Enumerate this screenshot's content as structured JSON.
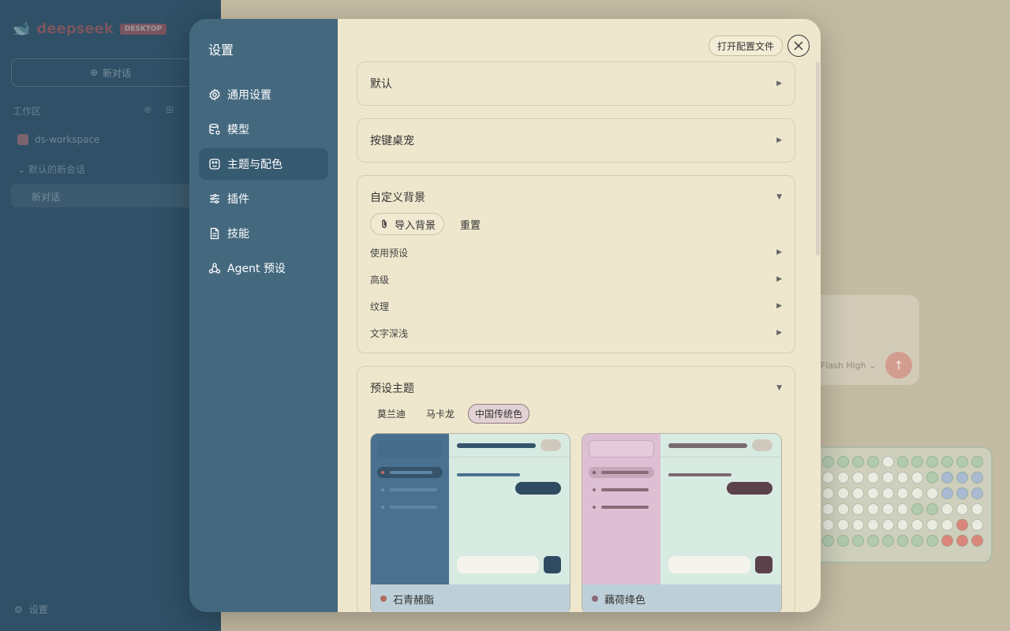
{
  "background": {
    "logo_text": "deepseek",
    "logo_badge": "DESKTOP",
    "new_chat": "新对话",
    "workspace_label": "工作区",
    "workspace_name": "ds-workspace",
    "session_group": "默认的新会话",
    "current_session": "新对话",
    "settings_label": "设置",
    "model_label": "Flash High"
  },
  "modal": {
    "title": "设置",
    "nav": [
      {
        "label": "通用设置",
        "icon": "gear-icon"
      },
      {
        "label": "模型",
        "icon": "database-icon"
      },
      {
        "label": "主题与配色",
        "icon": "palette-icon"
      },
      {
        "label": "插件",
        "icon": "sliders-icon"
      },
      {
        "label": "技能",
        "icon": "document-icon"
      },
      {
        "label": "Agent 预设",
        "icon": "agent-icon"
      }
    ],
    "active_nav_index": 2,
    "open_config_button": "打开配置文件",
    "sections": {
      "default": {
        "title": "默认"
      },
      "key_pet": {
        "title": "按键桌宠"
      },
      "custom_bg": {
        "title": "自定义背景",
        "import_button": "导入背景",
        "reset_button": "重置",
        "rows": [
          "使用预设",
          "高级",
          "纹理",
          "文字深浅"
        ]
      },
      "preset_themes": {
        "title": "预设主题",
        "tabs": [
          "莫兰迪",
          "马卡龙",
          "中国传统色"
        ],
        "active_tab_index": 2,
        "themes": [
          {
            "name": "石青赭脂",
            "sidebar_color": "#4a7190",
            "accent_color": "#b06a5e",
            "bubble_color": "#2f4b62"
          },
          {
            "name": "藕荷绛色",
            "sidebar_color": "#dcbfd3",
            "accent_color": "#8a6a77",
            "bubble_color": "#5b4149"
          }
        ]
      }
    }
  }
}
